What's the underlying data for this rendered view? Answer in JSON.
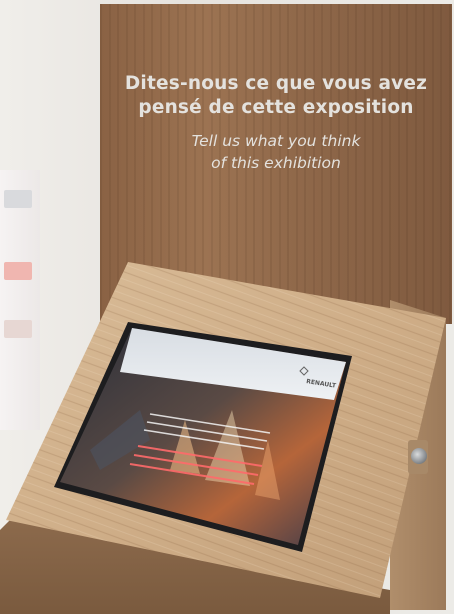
{
  "exhibit_sign": {
    "french_line1": "Dites-nous ce que vous avez",
    "french_line2": "pensé de cette exposition",
    "english_line1": "Tell us what you think",
    "english_line2": "of this exhibition"
  },
  "kiosk_screen": {
    "brand": "RENAULT"
  },
  "colors": {
    "sign_text": "#e4e2de",
    "wood_dark": "#8a6244",
    "wood_light": "#c9a884",
    "screen_text_red": "#ff6b6b"
  }
}
